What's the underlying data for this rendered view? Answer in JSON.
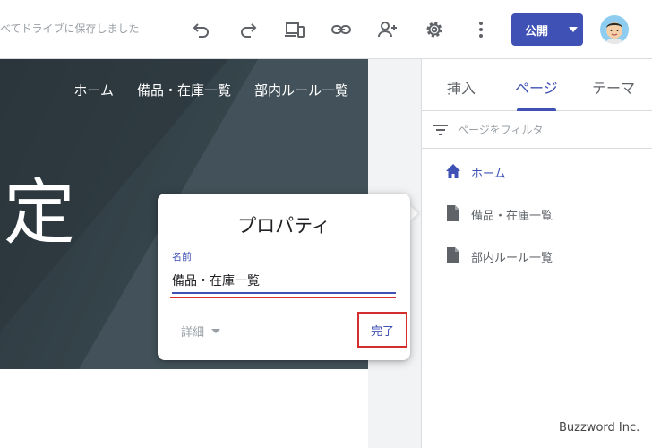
{
  "toolbar": {
    "save_status": "べてドライブに保存しました",
    "undo_icon": "undo-icon",
    "redo_icon": "redo-icon",
    "preview_icon": "devices-preview-icon",
    "link_icon": "link-icon",
    "share_icon": "add-person-icon",
    "settings_icon": "gear-icon",
    "more_icon": "more-vert-icon",
    "publish_label": "公開",
    "accent_color": "#3f51b5"
  },
  "site": {
    "nav": [
      "ホーム",
      "備品・在庫一覧",
      "部内ルール一覧"
    ],
    "hero_title": "定"
  },
  "panel": {
    "tabs": [
      "挿入",
      "ページ",
      "テーマ"
    ],
    "active_tab": "ページ",
    "filter_placeholder": "ページをフィルタ",
    "pages": [
      {
        "label": "ホーム",
        "icon": "home-icon",
        "active": true
      },
      {
        "label": "備品・在庫一覧",
        "icon": "page-icon",
        "active": false
      },
      {
        "label": "部内ルール一覧",
        "icon": "page-icon",
        "active": false
      }
    ]
  },
  "popup": {
    "title": "プロパティ",
    "name_label": "名前",
    "name_value": "備品・在庫一覧",
    "details_label": "詳細",
    "done_label": "完了"
  },
  "watermark": "Buzzword Inc."
}
